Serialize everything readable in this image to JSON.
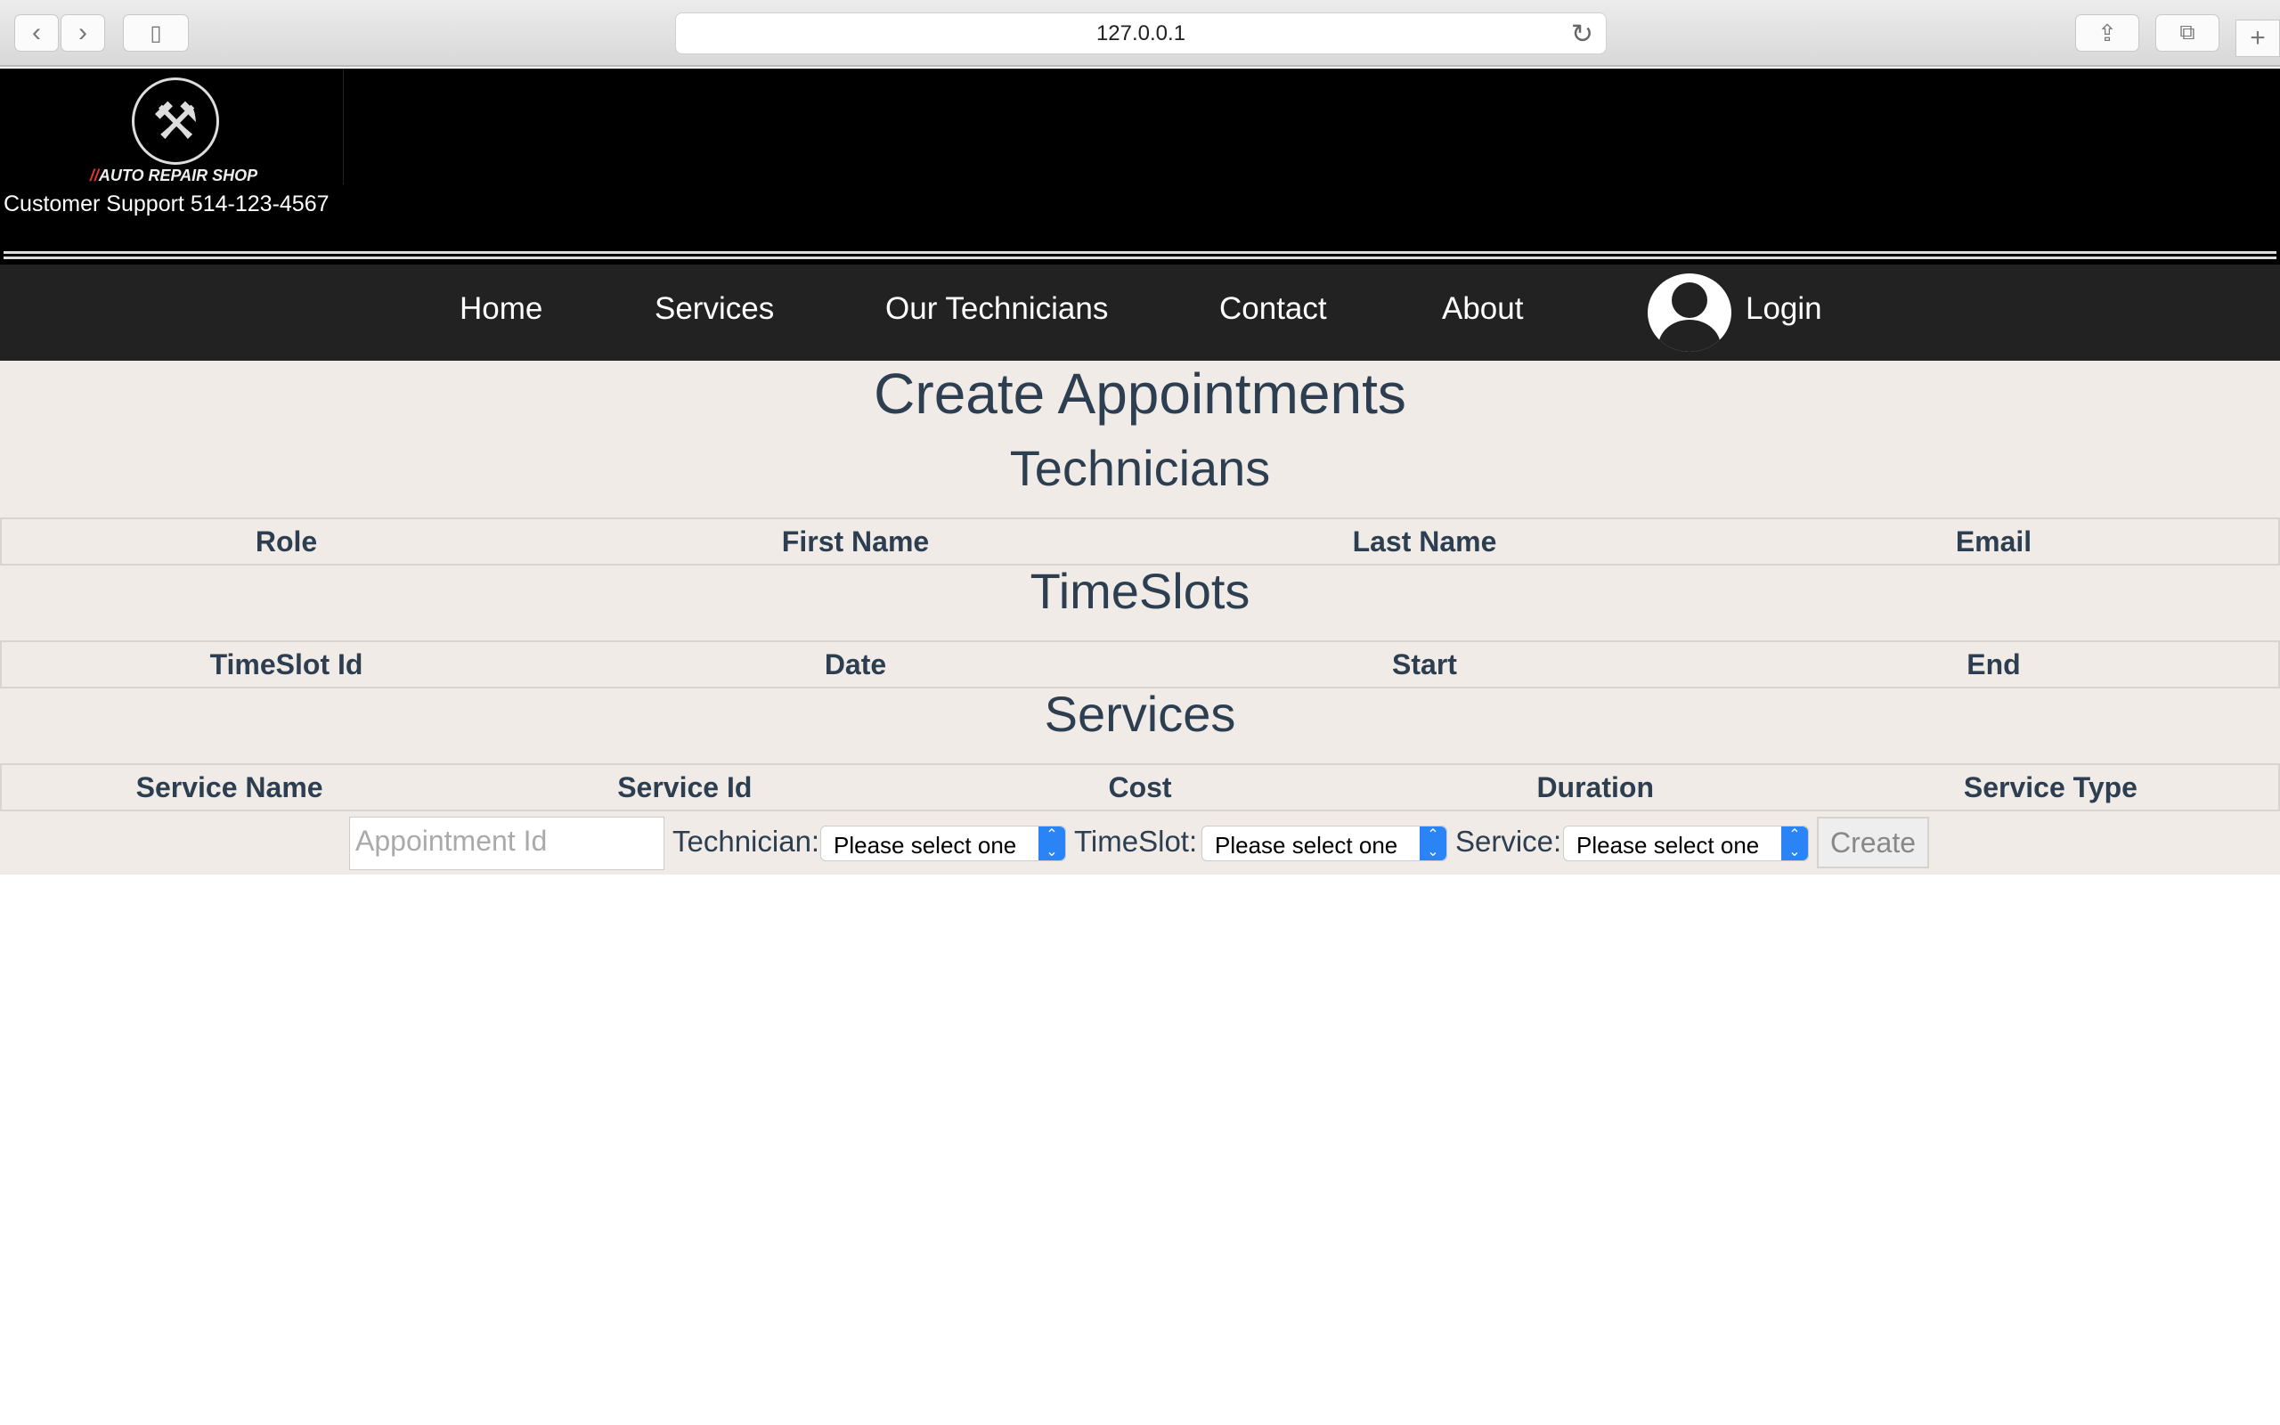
{
  "browser": {
    "url": "127.0.0.1"
  },
  "header": {
    "logo_text": "AUTO REPAIR SHOP",
    "logo_slashes": "//",
    "support": "Customer Support 514-123-4567"
  },
  "nav": {
    "items": [
      "Home",
      "Services",
      "Our Technicians",
      "Contact",
      "About"
    ],
    "login": "Login"
  },
  "main": {
    "title": "Create Appointments",
    "technicians": {
      "heading": "Technicians",
      "columns": [
        "Role",
        "First Name",
        "Last Name",
        "Email"
      ]
    },
    "timeslots": {
      "heading": "TimeSlots",
      "columns": [
        "TimeSlot Id",
        "Date",
        "Start",
        "End"
      ]
    },
    "services": {
      "heading": "Services",
      "columns": [
        "Service Name",
        "Service Id",
        "Cost",
        "Duration",
        "Service Type"
      ]
    },
    "form": {
      "appointment_placeholder": "Appointment Id",
      "technician_label": "Technician:",
      "timeslot_label": "TimeSlot:",
      "service_label": "Service:",
      "technician_value": "Please select one",
      "timeslot_value": "Please select one",
      "service_value": "Please select one",
      "create": "Create"
    }
  }
}
